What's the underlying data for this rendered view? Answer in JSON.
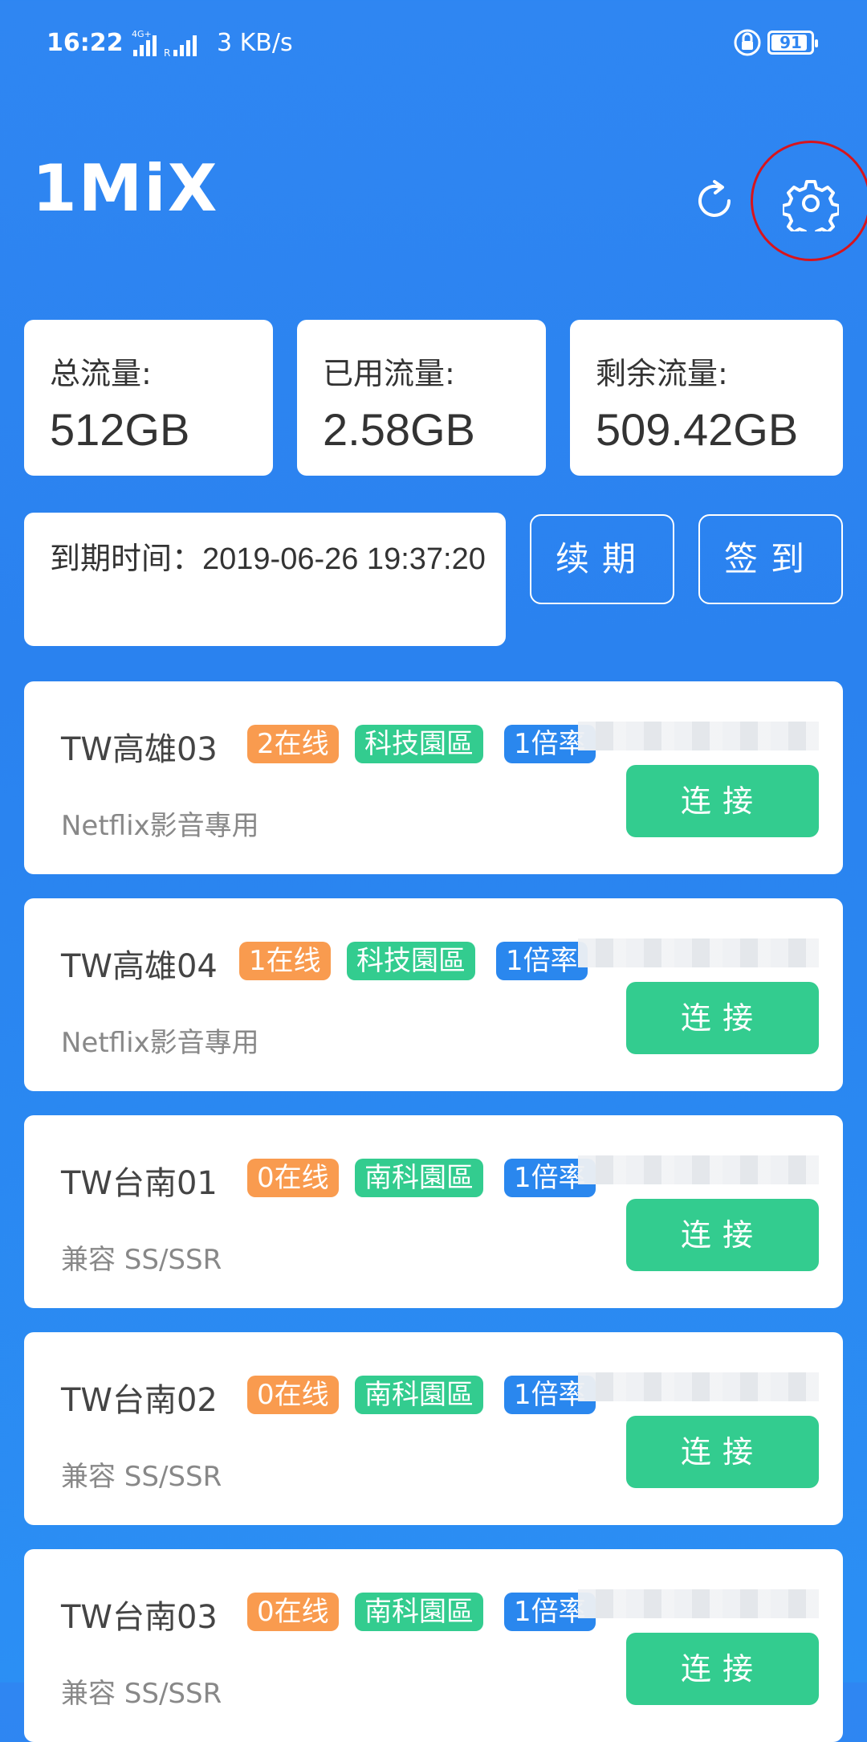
{
  "status_bar": {
    "time": "16:22",
    "speed": "3 KB/s",
    "battery": "91",
    "network": "4G+"
  },
  "header": {
    "logo": "1MiX"
  },
  "stats": [
    {
      "label": "总流量:",
      "value": "512GB"
    },
    {
      "label": "已用流量:",
      "value": "2.58GB"
    },
    {
      "label": "剩余流量:",
      "value": "509.42GB"
    }
  ],
  "expiry": {
    "text": "到期时间：2019-06-26 19:37:20"
  },
  "actions": {
    "renew": "续期",
    "checkin": "签到"
  },
  "servers": [
    {
      "name": "TW高雄03",
      "online": "2在线",
      "region": "科技園區",
      "rate": "1倍率",
      "desc": "Netflix影音專用",
      "connect": "连接"
    },
    {
      "name": "TW高雄04",
      "online": "1在线",
      "region": "科技園區",
      "rate": "1倍率",
      "desc": "Netflix影音專用",
      "connect": "连接"
    },
    {
      "name": "TW台南01",
      "online": "0在线",
      "region": "南科園區",
      "rate": "1倍率",
      "desc": "兼容 SS/SSR",
      "connect": "连接"
    },
    {
      "name": "TW台南02",
      "online": "0在线",
      "region": "南科園區",
      "rate": "1倍率",
      "desc": "兼容 SS/SSR",
      "connect": "连接"
    },
    {
      "name": "TW台南03",
      "online": "0在线",
      "region": "南科園區",
      "rate": "1倍率",
      "desc": "兼容 SS/SSR",
      "connect": "连接"
    }
  ],
  "colors": {
    "background": "#2f86f2",
    "online_tag": "#f99b4f",
    "region_tag": "#33cc8f",
    "rate_tag": "#2a87ee",
    "connect": "#33cc8f",
    "highlight_ring": "#d8141c"
  },
  "icons": {
    "refresh": "refresh-icon",
    "settings": "gear-icon"
  }
}
